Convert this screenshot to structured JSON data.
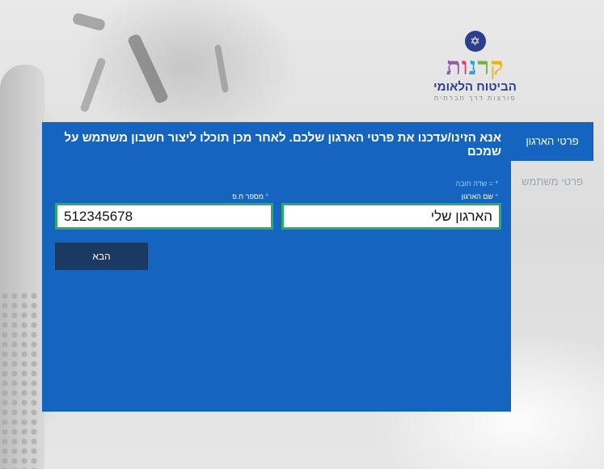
{
  "logo": {
    "wordmark": "קרנות",
    "wordmark_colors": [
      "#f0b400",
      "#6cb33f",
      "#25a3d9",
      "#e5327e",
      "#8e5ba8"
    ],
    "subtitle": "הביטוח הלאומי",
    "tagline": "פורצות דרך חברתית",
    "emblem_icon": "national-insurance-emblem"
  },
  "tabs": [
    {
      "label": "פרטי הארגון",
      "active": true
    },
    {
      "label": "פרטי משתמש",
      "active": false
    }
  ],
  "panel": {
    "title": "אנא הזינו/עדכנו את פרטי הארגון שלכם. לאחר מכן תוכלו ליצור חשבון משתמש על שמכם",
    "required_note": "* = שדה חובה",
    "fields": {
      "org_name": {
        "label": "שם הארגון",
        "value": "הארגון שלי"
      },
      "tax_number": {
        "label": "מספר ח.פ",
        "value": "512345678"
      }
    },
    "next_button": "הבא"
  },
  "colors": {
    "panel": "#1565c0",
    "button": "#1b3a63",
    "input_border": "#27ae60"
  }
}
